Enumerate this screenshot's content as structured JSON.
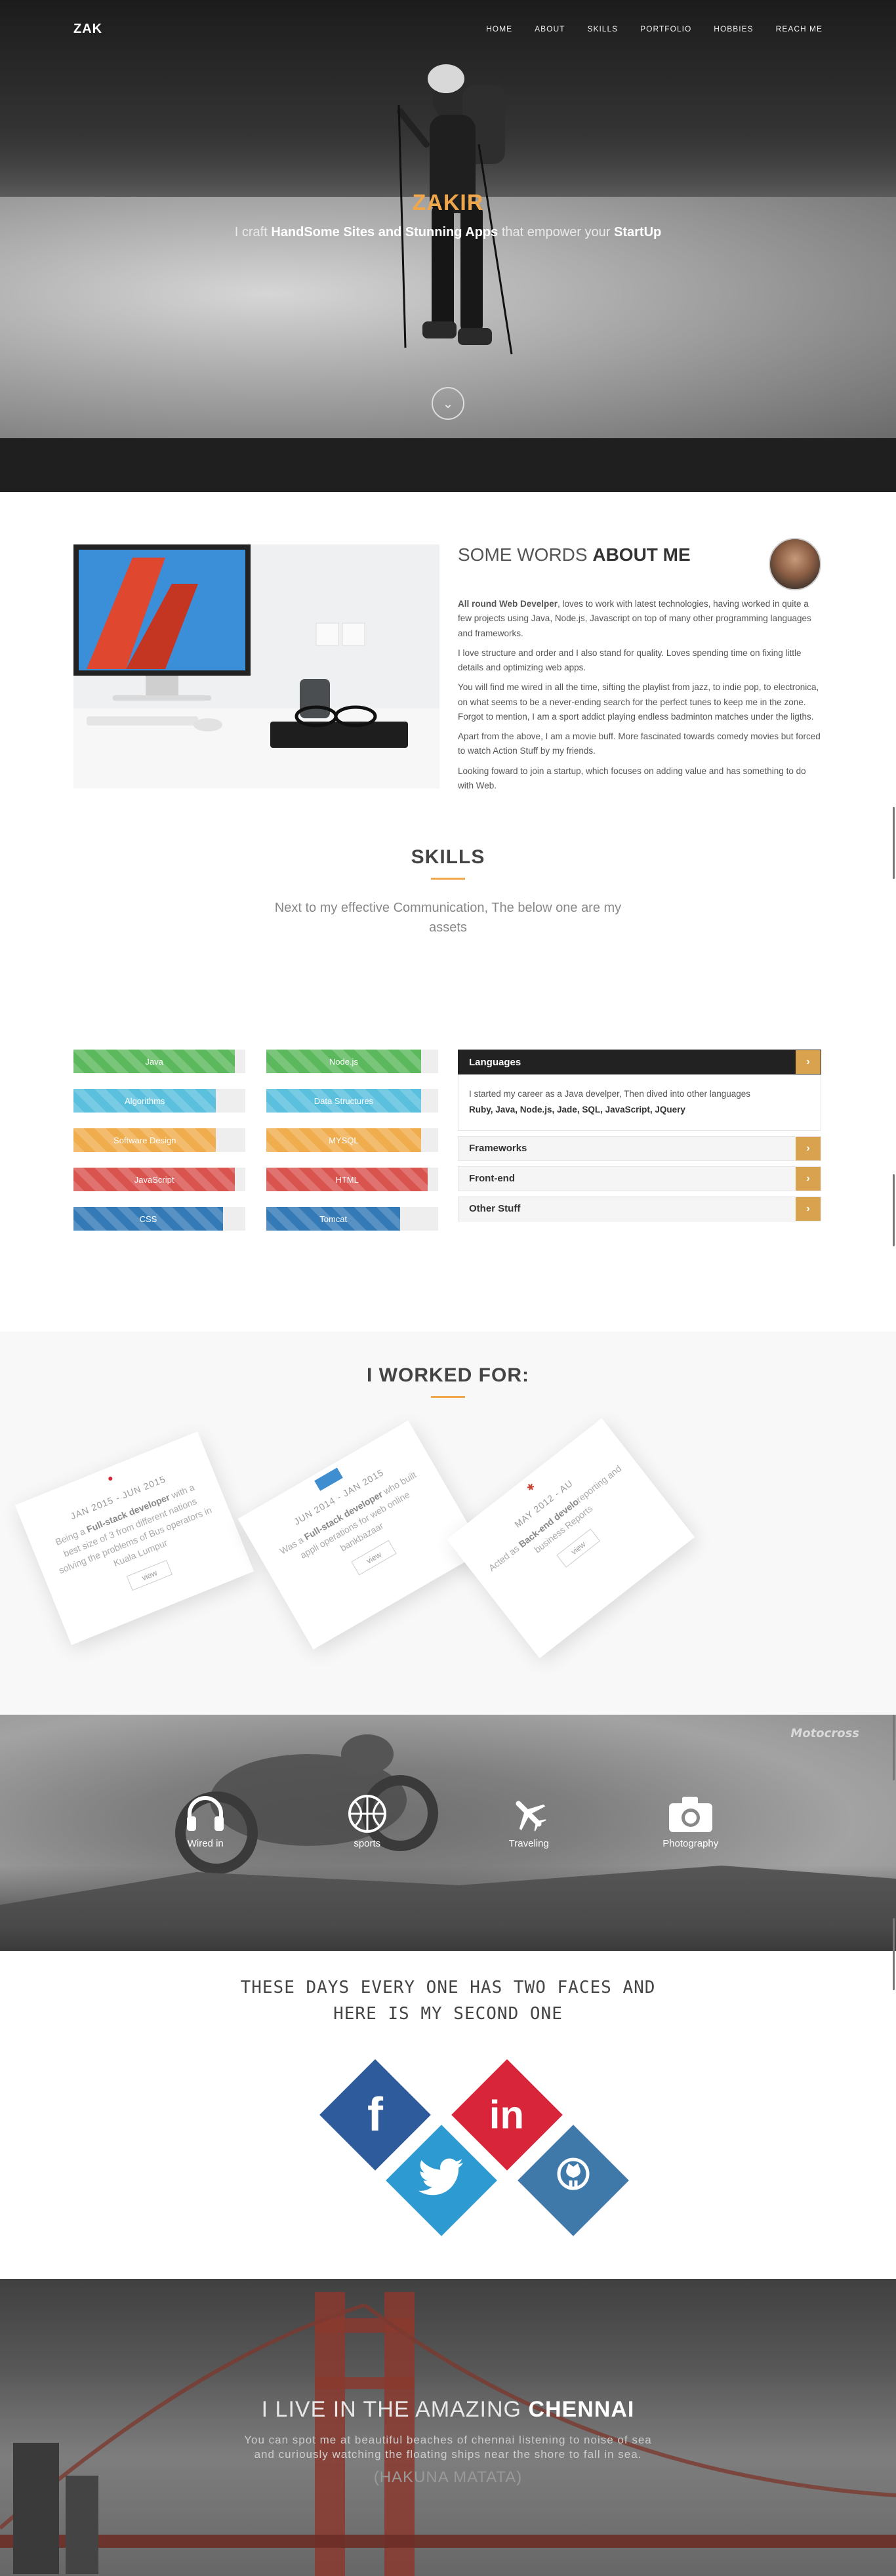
{
  "nav": {
    "brand": "ZAK",
    "items": [
      "HOME",
      "ABOUT",
      "SKILLS",
      "PORTFOLIO",
      "HOBBIES",
      "REACH ME"
    ]
  },
  "hero": {
    "name": "ZAKIR",
    "tag_pre": "I craft ",
    "tag_bold1": "HandSome Sites and Stunning Apps",
    "tag_mid": " that empower your ",
    "tag_bold2": "StartUp",
    "scroll_icon": "chevron-down-icon"
  },
  "about": {
    "title_light": "SOME WORDS ",
    "title_bold": "ABOUT ME",
    "p1_bold": "All round Web Develper",
    "p1_rest": ", loves to work with latest technologies, having worked in quite a few projects using Java, Node.js, Javascript on top of many other programming languages and frameworks.",
    "p2": "I love structure and order and I also stand for quality. Loves spending time on fixing little details and optimizing web apps.",
    "p3": "You will find me wired in all the time, sifting the playlist from jazz, to indie pop, to electronica, on what seems to be a never-ending search for the perfect tunes to keep me in the zone. Forgot to mention, I am a sport addict playing endless badminton matches under the ligths.",
    "p4": "Apart from the above, I am a movie buff. More fascinated towards comedy movies but forced to watch Action Stuff by my friends.",
    "p5": "Looking foward to join a startup, which focuses on adding value and has something to do with Web."
  },
  "skills": {
    "title": "SKILLS",
    "subtitle": "Next to my effective Communication, The below one are my assets",
    "bars": [
      {
        "label": "Java",
        "level": 0.94,
        "color": "#5cb85c"
      },
      {
        "label": "Node.js",
        "level": 0.9,
        "color": "#5cb85c"
      },
      {
        "label": "Algorithms",
        "level": 0.83,
        "color": "#5bc0de"
      },
      {
        "label": "Data Structures",
        "level": 0.9,
        "color": "#5bc0de"
      },
      {
        "label": "Software Design",
        "level": 0.83,
        "color": "#f0ad4e"
      },
      {
        "label": "MYSQL",
        "level": 0.9,
        "color": "#f0ad4e"
      },
      {
        "label": "JavaScript",
        "level": 0.94,
        "color": "#d9534f"
      },
      {
        "label": "HTML",
        "level": 0.94,
        "color": "#d9534f"
      },
      {
        "label": "CSS",
        "level": 0.87,
        "color": "#337ab7"
      },
      {
        "label": "Tomcat",
        "level": 0.78,
        "color": "#337ab7"
      }
    ],
    "accordion": {
      "items": [
        "Languages",
        "Frameworks",
        "Front-end",
        "Other Stuff"
      ],
      "open_text": "I started my career as a Java develper, Then dived into other languages",
      "open_list": "Ruby, Java, Node.js, Jade, SQL, JavaScript, JQuery"
    }
  },
  "work": {
    "title": "I WORKED FOR:",
    "cards": [
      {
        "dates": "JAN 2015 - JUN 2015",
        "pre": "Being a ",
        "bold": "Full-stack developer",
        "rest": " with a best size of 3 from different nations solving the problems of Bus operators in Kuala Lumpur",
        "view": "view"
      },
      {
        "dates": "JUN 2014 - JAN 2015",
        "pre": "Was a ",
        "bold": "Full-stack developer",
        "rest": " who built appli operations for web online bankbazaar",
        "view": "view"
      },
      {
        "dates": "MAY 2012 - AU",
        "pre": "Acted as ",
        "bold": "Back-end develo",
        "rest": "reporting and business Reports",
        "view": "view"
      }
    ]
  },
  "hobbies": {
    "watermark": "Motocross",
    "items": [
      {
        "label": "Wired in",
        "icon": "headphones-icon"
      },
      {
        "label": "sports",
        "icon": "basketball-icon"
      },
      {
        "label": "Traveling",
        "icon": "airplane-icon"
      },
      {
        "label": "Photography",
        "icon": "camera-icon"
      }
    ]
  },
  "social": {
    "quote_line1": "THESE DAYS EVERY ONE HAS TWO FACES AND",
    "quote_line2": "HERE IS MY SECOND ONE",
    "links": [
      {
        "name": "facebook",
        "glyph": "f",
        "color": "#2d5b9c"
      },
      {
        "name": "linkedin",
        "glyph": "in",
        "color": "#d9253a"
      },
      {
        "name": "twitter",
        "glyph": "twitter-icon",
        "color": "#2d9ad1"
      },
      {
        "name": "github",
        "glyph": "github-icon",
        "color": "#3f79a9"
      }
    ]
  },
  "city": {
    "title_light": "I LIVE IN THE AMAZING ",
    "title_bold": "CHENNAI",
    "desc": "You can spot me at beautiful beaches of chennai listening to noise of sea and curiously watching the floating ships near the shore to fall in sea.",
    "sub": "(HAKUNA MATATA)"
  }
}
